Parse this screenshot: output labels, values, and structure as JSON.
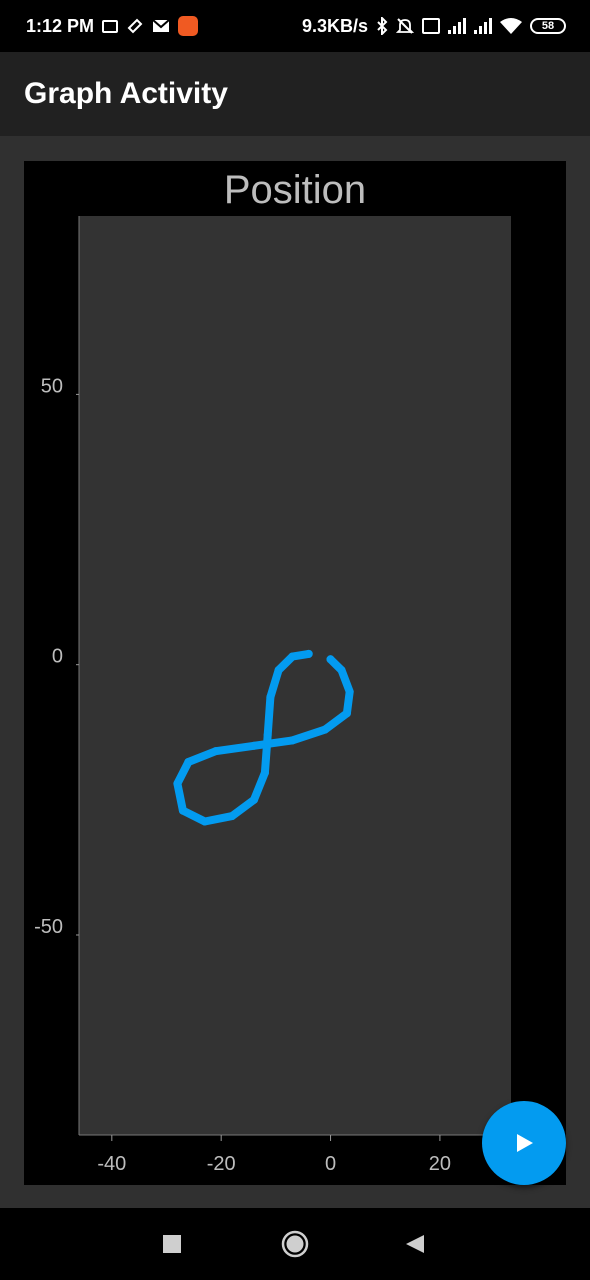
{
  "status_bar": {
    "time": "1:12 PM",
    "net_speed": "9.3KB/s",
    "battery": "58",
    "icons": [
      "vpn-key-icon",
      "ticket-icon",
      "gmail-icon",
      "app-notification-icon",
      "bluetooth-icon",
      "mute-icon",
      "volte-icon",
      "signal-icon",
      "signal-icon",
      "wifi-icon",
      "battery-icon"
    ]
  },
  "app_bar": {
    "title": "Graph Activity"
  },
  "chart_data": {
    "type": "line",
    "title": "Position",
    "xlabel": "",
    "ylabel": "",
    "xlim": [
      -46,
      33
    ],
    "ylim": [
      -87,
      83
    ],
    "x_ticks": [
      -40,
      -20,
      0,
      20
    ],
    "y_ticks": [
      50,
      0,
      -50
    ],
    "grid": false,
    "colors": {
      "line": "#039BF0",
      "plot_bg": "#333333",
      "frame_bg": "#000000",
      "text": "#BDBDBD"
    },
    "series": [
      {
        "values": [
          {
            "x": -4,
            "y": 2
          },
          {
            "x": -7,
            "y": 1.5
          },
          {
            "x": -9.5,
            "y": -1
          },
          {
            "x": -11,
            "y": -6
          },
          {
            "x": -11.5,
            "y": -13
          },
          {
            "x": -12,
            "y": -20
          },
          {
            "x": -14,
            "y": -25
          },
          {
            "x": -18,
            "y": -28
          },
          {
            "x": -23,
            "y": -29
          },
          {
            "x": -27,
            "y": -27
          },
          {
            "x": -28,
            "y": -22
          },
          {
            "x": -26,
            "y": -18
          },
          {
            "x": -21,
            "y": -16
          },
          {
            "x": -14,
            "y": -15
          },
          {
            "x": -7,
            "y": -14
          },
          {
            "x": -1,
            "y": -12
          },
          {
            "x": 3,
            "y": -9
          },
          {
            "x": 3.5,
            "y": -5
          },
          {
            "x": 2,
            "y": -1
          },
          {
            "x": 0,
            "y": 1
          }
        ]
      }
    ]
  },
  "fab": {
    "icon": "play-icon"
  },
  "nav_bar": {
    "icons": [
      "recents-square-icon",
      "home-circle-icon",
      "back-triangle-icon"
    ]
  }
}
